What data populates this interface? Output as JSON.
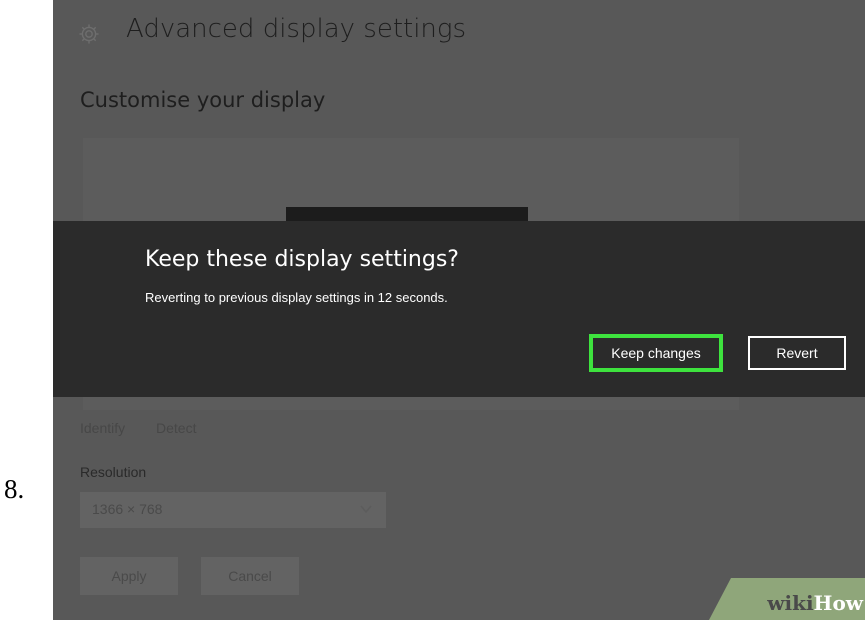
{
  "step_number": "8.",
  "window": {
    "title": "Advanced display settings",
    "icon": "gear-icon"
  },
  "display": {
    "heading": "Customise your display",
    "identify_label": "Identify",
    "detect_label": "Detect"
  },
  "resolution": {
    "label": "Resolution",
    "value": "1366 × 768"
  },
  "buttons": {
    "apply_label": "Apply",
    "cancel_label": "Cancel"
  },
  "dialog": {
    "title": "Keep these display settings?",
    "message": "Reverting to previous display settings in 12 seconds.",
    "keep_label": "Keep changes",
    "revert_label": "Revert"
  },
  "watermark": {
    "wiki": "wiki",
    "how": "How"
  },
  "colors": {
    "highlight": "#3ee33e",
    "dialog_background": "#2b2b2b",
    "dimmed_background": "#585858"
  }
}
